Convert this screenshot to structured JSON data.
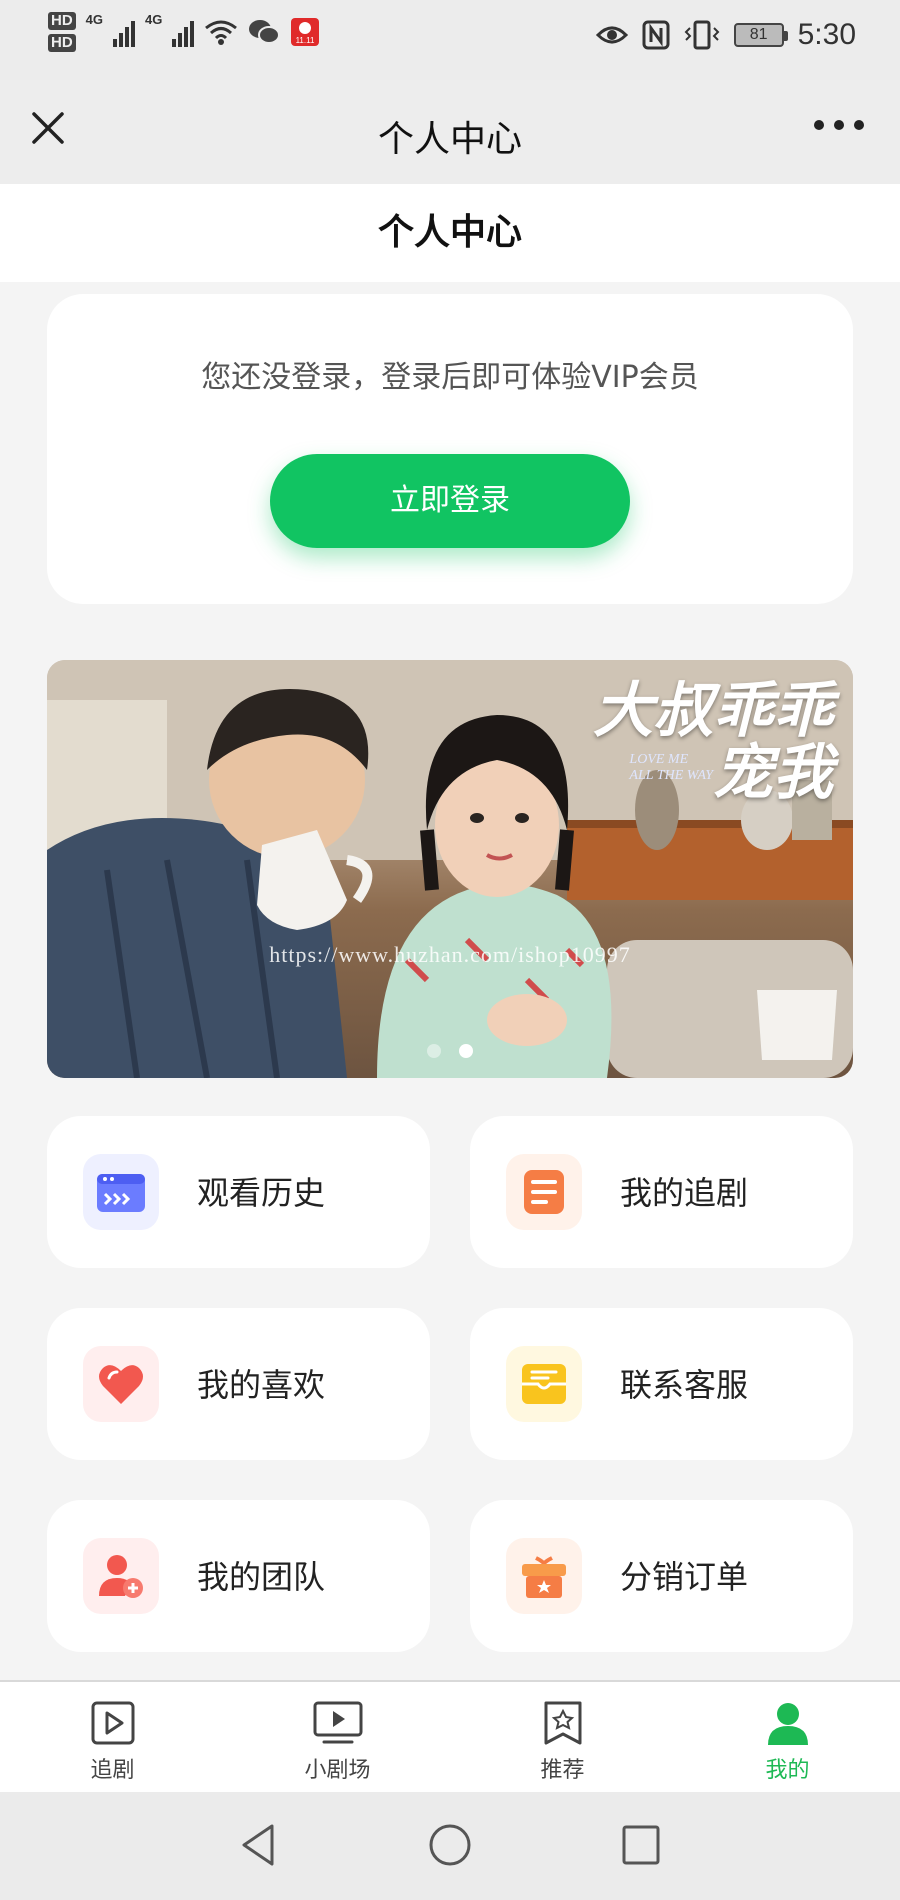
{
  "status_bar": {
    "hd1": "HD",
    "hd2": "HD",
    "net1": "4G",
    "net2": "4G",
    "battery": "81",
    "time": "5:30"
  },
  "wechat_nav": {
    "title": "个人中心"
  },
  "page": {
    "title": "个人中心"
  },
  "login": {
    "tip": "您还没登录，登录后即可体验VIP会员",
    "button": "立即登录"
  },
  "banner": {
    "title_line1": "大叔乖乖",
    "title_line2": "宠我",
    "subtitle_line1": "LOVE ME",
    "subtitle_line2": "ALL THE WAY",
    "watermark": "https://www.huzhan.com/ishop10997",
    "slide_count": 2,
    "active_slide": 2
  },
  "menu": [
    {
      "label": "观看历史",
      "icon": "history-icon"
    },
    {
      "label": "我的追剧",
      "icon": "drama-list-icon"
    },
    {
      "label": "我的喜欢",
      "icon": "heart-icon"
    },
    {
      "label": "联系客服",
      "icon": "mail-icon"
    },
    {
      "label": "我的团队",
      "icon": "team-icon"
    },
    {
      "label": "分销订单",
      "icon": "gift-order-icon"
    }
  ],
  "tabs": [
    {
      "label": "追剧",
      "icon": "play-icon",
      "active": false
    },
    {
      "label": "小剧场",
      "icon": "tv-icon",
      "active": false
    },
    {
      "label": "推荐",
      "icon": "star-bookmark-icon",
      "active": false
    },
    {
      "label": "我的",
      "icon": "user-icon",
      "active": true
    }
  ],
  "colors": {
    "primary_green": "#11c462",
    "active_tab": "#1db954"
  }
}
